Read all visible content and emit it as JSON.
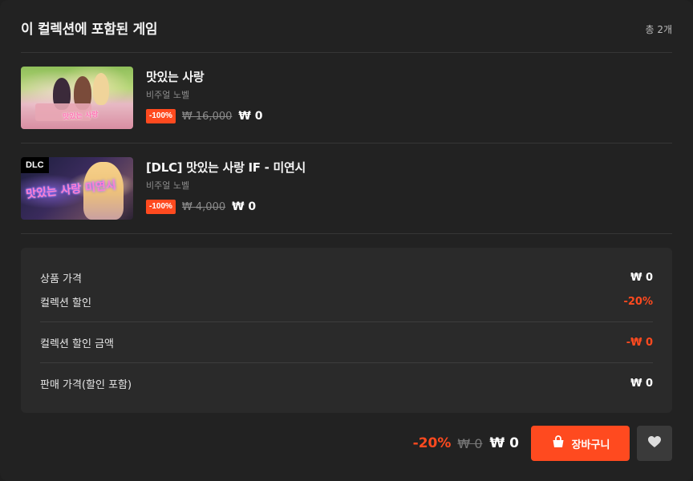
{
  "header": {
    "title": "이 컬렉션에 포함된 게임",
    "count": "총 2개"
  },
  "games": [
    {
      "title": "맛있는 사랑",
      "genre": "비주얼 노벨",
      "discount": "-100%",
      "original_price": "₩ 16,000",
      "final_price": "₩ 0",
      "thumbnail_art_text": "맛있는 사랑"
    },
    {
      "title": "[DLC] 맛있는 사랑 IF - 미연시",
      "genre": "비주얼 노벨",
      "discount": "-100%",
      "original_price": "₩ 4,000",
      "final_price": "₩ 0",
      "badge": "DLC",
      "thumbnail_art_text": "맛있는 사랑 미연시"
    }
  ],
  "summary": {
    "product_price_label": "상품 가격",
    "product_price_value": "₩ 0",
    "collection_discount_label": "컬렉션 할인",
    "collection_discount_value": "-20%",
    "collection_discount_amount_label": "컬렉션 할인 금액",
    "collection_discount_amount_value": "-₩ 0",
    "sale_price_label": "판매 가격(할인 포함)",
    "sale_price_value": "₩ 0"
  },
  "footer": {
    "discount": "-20%",
    "original_price": "₩ 0",
    "final_price": "₩ 0",
    "cart_label": "장바구니",
    "cart_icon": "shopping-basket-icon",
    "wishlist_icon": "heart-icon"
  },
  "colors": {
    "accent": "#ff4a1f",
    "panel_bg": "#222222",
    "summary_bg": "#2a2a2a"
  }
}
